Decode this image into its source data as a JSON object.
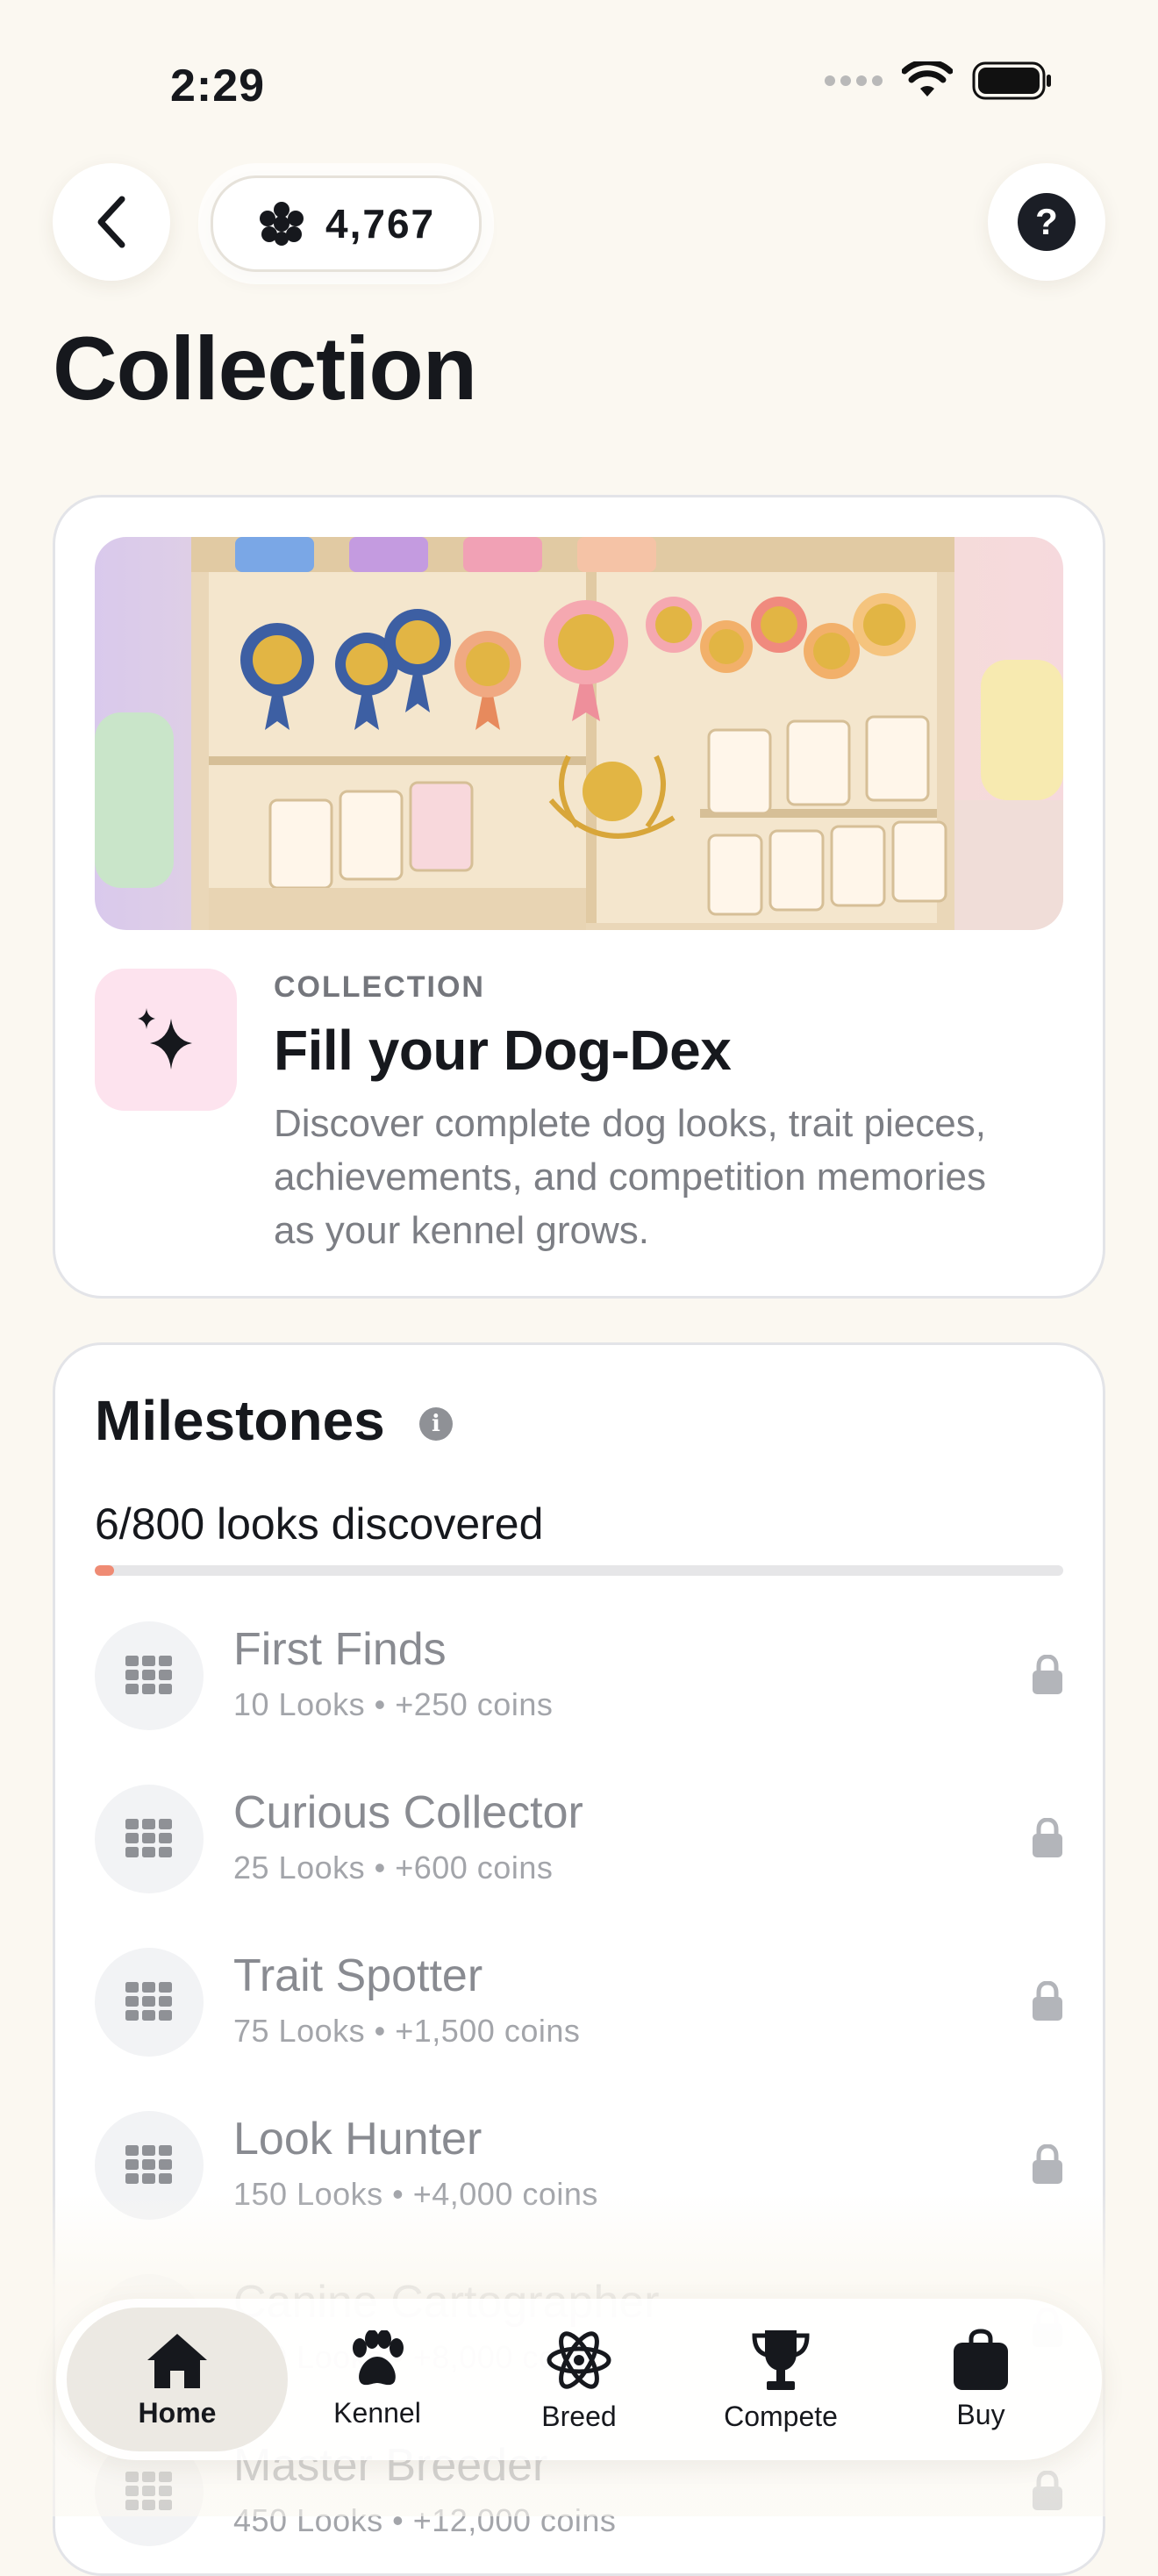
{
  "status_bar": {
    "time": "2:29"
  },
  "header": {
    "coins": "4,767"
  },
  "page_title": "Collection",
  "feature": {
    "eyebrow": "COLLECTION",
    "title": "Fill your Dog-Dex",
    "description": "Discover complete dog looks, trait pieces, achievements, and competition memories as your kennel grows."
  },
  "milestones": {
    "title": "Milestones",
    "progress_label": "6/800 looks discovered",
    "progress_fraction": 0.0075,
    "items": [
      {
        "name": "First Finds",
        "detail": "10 Looks • +250 coins"
      },
      {
        "name": "Curious Collector",
        "detail": "25 Looks • +600 coins"
      },
      {
        "name": "Trait Spotter",
        "detail": "75 Looks • +1,500 coins"
      },
      {
        "name": "Look Hunter",
        "detail": "150 Looks • +4,000 coins"
      },
      {
        "name": "Canine Cartographer",
        "detail": "300 Looks • +8,000 coins"
      },
      {
        "name": "Master Breeder",
        "detail": "450 Looks • +12,000 coins"
      }
    ]
  },
  "tabs": [
    {
      "label": "Home",
      "icon": "home-icon",
      "active": true
    },
    {
      "label": "Kennel",
      "icon": "paw-icon"
    },
    {
      "label": "Breed",
      "icon": "atom-icon"
    },
    {
      "label": "Compete",
      "icon": "trophy-icon"
    },
    {
      "label": "Buy",
      "icon": "bag-icon"
    }
  ],
  "colors": {
    "background": "#fbf8f1",
    "accent_progress": "#ef8b74",
    "sparkle_tile": "#fde3ee",
    "text_primary": "#16181d",
    "text_muted": "#898b91"
  }
}
